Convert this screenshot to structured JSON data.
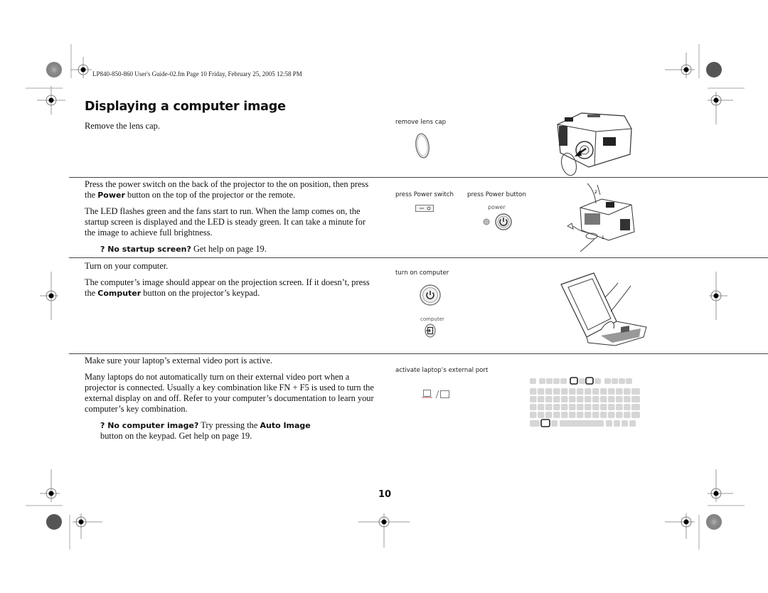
{
  "header": {
    "file_info": "LP840-850-860 User's Guide-02.fm  Page 10  Friday, February 25, 2005  12:58 PM"
  },
  "title": "Displaying a computer image",
  "sections": [
    {
      "paragraphs": [
        "Remove the lens cap."
      ],
      "captions": [
        "remove lens cap"
      ],
      "illustrations": [
        "lens-cap",
        "projector-lens-cap-removal"
      ]
    },
    {
      "paragraphs": [
        {
          "pre": "Press the power switch on the back of the projector to the on position, then press the ",
          "bold": "Power",
          "post": " button on the top of the projector or the remote."
        },
        "The LED flashes green and the fans start to run. When the lamp comes on, the startup screen is displayed and the LED is steady green. It can take a minute for the image to achieve full brightness."
      ],
      "help": {
        "bold": "? No startup screen?",
        "text": " Get help on page 19."
      },
      "captions": [
        "press Power switch",
        "press Power button"
      ],
      "button_label": "power",
      "illustrations": [
        "power-switch",
        "power-button",
        "projector-power-cord"
      ]
    },
    {
      "paragraphs": [
        "Turn on your computer.",
        {
          "pre": "The computer’s image should appear on the projection screen. If it doesn’t, press the ",
          "bold": "Computer",
          "post": " button on the projector’s keypad."
        }
      ],
      "captions": [
        "turn on computer"
      ],
      "button_label": "computer",
      "illustrations": [
        "computer-power-button",
        "computer-source-button",
        "laptop"
      ]
    },
    {
      "paragraphs": [
        "Make sure your laptop’s external video port is active.",
        "Many laptops do not automatically turn on their external video port when a projector is connected. Usually a key combination like FN + F5 is used to turn the external display on and off. Refer to your computer’s documentation to learn your computer’s key combination."
      ],
      "help": {
        "bold": "? No computer image?",
        "mid": " Try pressing the ",
        "bold2": "Auto Image",
        "text": " button on the keypad. Get help on page 19."
      },
      "captions": [
        "activate laptop’s external port"
      ],
      "illustrations": [
        "laptop-monitor-toggle-icon",
        "keyboard-fn-f5"
      ]
    }
  ],
  "page_number": "10"
}
